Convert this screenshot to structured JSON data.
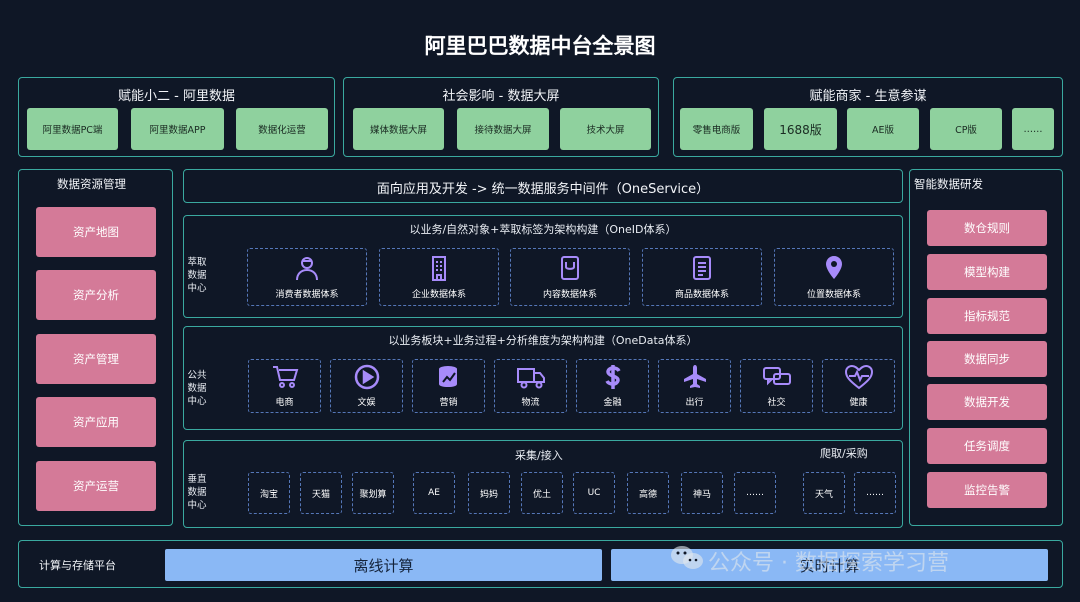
{
  "title": "阿里巴巴数据中台全景图",
  "top_panels": [
    {
      "title": "赋能小二 - 阿里数据",
      "buttons": [
        "阿里数据PC端",
        "阿里数据APP",
        "数据化运营"
      ]
    },
    {
      "title": "社会影响 - 数据大屏",
      "buttons": [
        "媒体数据大屏",
        "接待数据大屏",
        "技术大屏"
      ]
    },
    {
      "title": "赋能商家 - 生意参谋",
      "buttons": [
        "零售电商版",
        "1688版",
        "AE版",
        "CP版",
        "……"
      ]
    }
  ],
  "left_panel": {
    "title": "数据资源管理",
    "items": [
      "资产地图",
      "资产分析",
      "资产管理",
      "资产应用",
      "资产运营"
    ]
  },
  "right_panel": {
    "title": "智能数据研发",
    "items": [
      "数仓规则",
      "模型构建",
      "指标规范",
      "数据同步",
      "数据开发",
      "任务调度",
      "监控告警"
    ]
  },
  "oneservice": "面向应用及开发 -> 统一数据服务中间件（OneService）",
  "extract": {
    "label": "萃取\n数据\n中心",
    "title": "以业务/自然对象+萃取标签为架构构建（OneID体系）",
    "items": [
      {
        "label": "消费者数据体系",
        "icon": "consumer-icon"
      },
      {
        "label": "企业数据体系",
        "icon": "building-icon"
      },
      {
        "label": "内容数据体系",
        "icon": "content-icon"
      },
      {
        "label": "商品数据体系",
        "icon": "document-icon"
      },
      {
        "label": "位置数据体系",
        "icon": "location-pin-icon"
      }
    ]
  },
  "public": {
    "label": "公共\n数据\n中心",
    "title": "以业务板块+业务过程+分析维度为架构构建（OneData体系）",
    "items": [
      {
        "label": "电商",
        "icon": "shopping-cart-icon"
      },
      {
        "label": "文娱",
        "icon": "play-icon"
      },
      {
        "label": "营销",
        "icon": "database-chart-icon"
      },
      {
        "label": "物流",
        "icon": "truck-icon"
      },
      {
        "label": "金融",
        "icon": "dollar-icon"
      },
      {
        "label": "出行",
        "icon": "airplane-icon"
      },
      {
        "label": "社交",
        "icon": "chat-icon"
      },
      {
        "label": "健康",
        "icon": "heart-icon"
      }
    ]
  },
  "vertical": {
    "label": "垂直\n数据\n中心",
    "collect_title": "采集/接入",
    "crawl_title": "爬取/采购",
    "collect_items": [
      "淘宝",
      "天猫",
      "聚划算",
      "AE",
      "妈妈",
      "优土",
      "UC",
      "高德",
      "神马",
      "……"
    ],
    "crawl_items": [
      "天气",
      "……"
    ]
  },
  "bottom": {
    "label": "计算与存储平台",
    "offline": "离线计算",
    "realtime": "实时计算"
  },
  "watermark": "公众号 · 数据探索学习营",
  "colors": {
    "background": "#0f1726",
    "border": "#3aa99f",
    "green": "#8fd19e",
    "pink": "#d47a98",
    "blue": "#8ab8f5",
    "icon_purple": "#a78bfa"
  }
}
